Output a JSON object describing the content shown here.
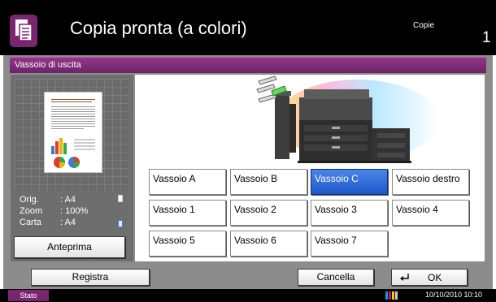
{
  "header": {
    "title": "Copia pronta (a colori)",
    "copies_label": "Copie",
    "copies_value": "1"
  },
  "section": {
    "title": "Vassoio di uscita"
  },
  "preview": {
    "orig_label": "Orig.",
    "orig_value": ": A4",
    "zoom_label": "Zoom",
    "zoom_value": ": 100%",
    "paper_label": "Carta",
    "paper_value": ": A4",
    "preview_button": "Anteprima"
  },
  "trays": [
    {
      "label": "Vassoio A",
      "selected": false
    },
    {
      "label": "Vassoio B",
      "selected": false
    },
    {
      "label": "Vassoio C",
      "selected": true
    },
    {
      "label": "Vassoio destro",
      "selected": false
    },
    {
      "label": "Vassoio 1",
      "selected": false
    },
    {
      "label": "Vassoio 2",
      "selected": false
    },
    {
      "label": "Vassoio 3",
      "selected": false
    },
    {
      "label": "Vassoio 4",
      "selected": false
    },
    {
      "label": "Vassoio 5",
      "selected": false
    },
    {
      "label": "Vassoio 6",
      "selected": false
    },
    {
      "label": "Vassoio 7",
      "selected": false
    }
  ],
  "footer": {
    "register_button": "Registra",
    "cancel_button": "Cancella",
    "ok_button": "OK"
  },
  "status": {
    "status_button": "Stato",
    "datetime": "10/10/2010  10:10"
  },
  "colors": {
    "accent_purple": "#7a2570",
    "selected_blue": "#1d57c9"
  }
}
